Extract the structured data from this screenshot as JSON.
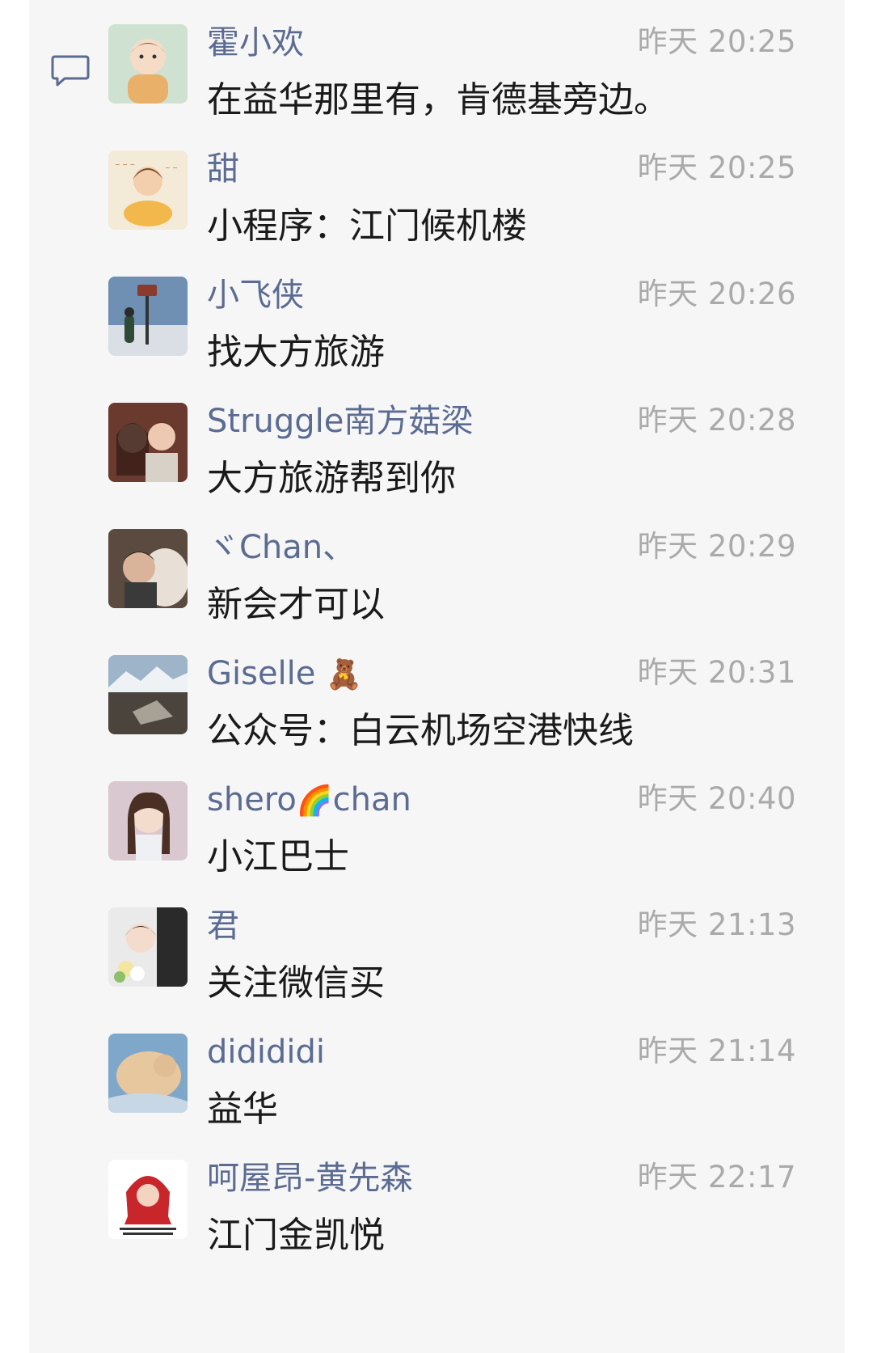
{
  "icons": {
    "comment": "comment-bubble-icon"
  },
  "colors": {
    "author": "#5b6b92",
    "time": "#aaaaaa",
    "message": "#1a1a1a",
    "panel": "#f6f6f6"
  },
  "comments": [
    {
      "author": "霍小欢",
      "time": "昨天 20:25",
      "text": "在益华那里有，肯德基旁边。"
    },
    {
      "author": "甜",
      "time": "昨天 20:25",
      "text": "小程序：江门候机楼"
    },
    {
      "author": "小飞侠",
      "time": "昨天 20:26",
      "text": "找大方旅游"
    },
    {
      "author": "Struggle南方菇梁",
      "time": "昨天 20:28",
      "text": "大方旅游帮到你"
    },
    {
      "author": "ヾChan、",
      "time": "昨天 20:29",
      "text": "新会才可以"
    },
    {
      "author": "Giselle",
      "author_emoji": "🧸",
      "time": "昨天 20:31",
      "text": "公众号：白云机场空港快线"
    },
    {
      "author": "shero",
      "author_emoji": "🌈",
      "author_suffix": "chan",
      "time": "昨天 20:40",
      "text": "小江巴士"
    },
    {
      "author": "君",
      "time": "昨天 21:13",
      "text": "关注微信买"
    },
    {
      "author": "didididi",
      "time": "昨天 21:14",
      "text": "益华"
    },
    {
      "author": "呵屋昂-黄先森",
      "time": "昨天 22:17",
      "text": "江门金凯悦"
    }
  ]
}
